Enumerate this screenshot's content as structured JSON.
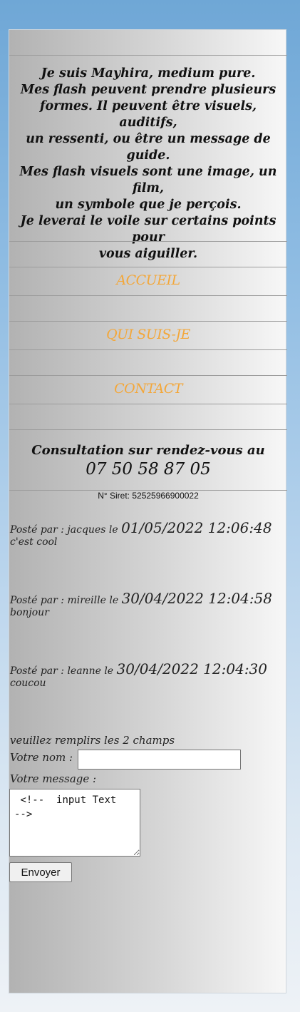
{
  "intro": {
    "lines": [
      "Je suis Mayhira, medium pure.",
      "Mes flash peuvent prendre plusieurs",
      "formes. Il peuvent être visuels, auditifs,",
      "un ressenti, ou être un message de guide.",
      "Mes flash visuels sont une image, un film,",
      "un symbole que je perçois.",
      "Je leverai le voile sur certains points pour",
      "vous aiguiller."
    ]
  },
  "nav": {
    "items": [
      {
        "label": "ACCUEIL"
      },
      {
        "label": "QUI SUIS-JE"
      },
      {
        "label": "CONTACT"
      }
    ],
    "color": "#f3a73a"
  },
  "consultation": {
    "text": "Consultation sur rendez-vous au",
    "phone": "07 50 58 87 05"
  },
  "siret": "N° Siret: 52525966900022",
  "posts": [
    {
      "meta": "Posté par : jacques le ",
      "date": "01/05/2022 12:06:48",
      "message": "c'est cool"
    },
    {
      "meta": "Posté par : mireille le ",
      "date": "30/04/2022 12:04:58",
      "message": "bonjour"
    },
    {
      "meta": "Posté par : leanne le ",
      "date": "30/04/2022 12:04:30",
      "message": "coucou"
    }
  ],
  "form": {
    "instruction": "veuillez remplirs les 2 champs",
    "name_label": "Votre nom :",
    "name_value": "",
    "message_label": "Votre message :",
    "message_value": " <!--  input Text\n-->",
    "submit_label": "Envoyer"
  }
}
